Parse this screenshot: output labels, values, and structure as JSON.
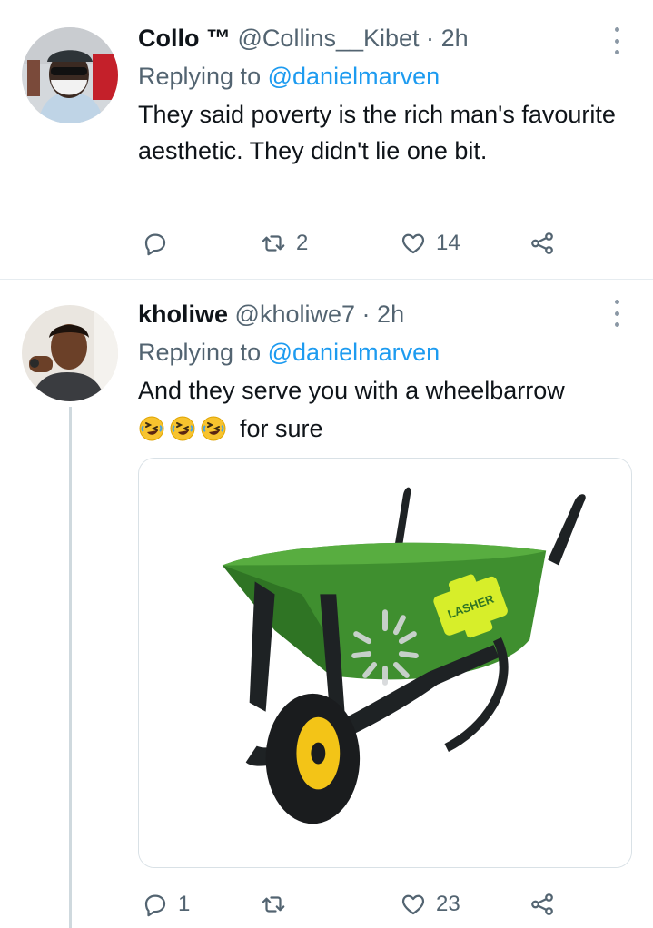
{
  "tweets": [
    {
      "name": "Collo ™",
      "handle": "@Collins__Kibet",
      "separator": "·",
      "time": "2h",
      "replying_prefix": "Replying to",
      "replying_to": "@danielmarven",
      "text": "They said poverty is the rich man's favourite aesthetic. They didn't lie one bit.",
      "stats": {
        "replies": "",
        "retweets": "2",
        "likes": "14"
      }
    },
    {
      "name": "kholiwe",
      "handle": "@kholiwe7",
      "separator": "·",
      "time": "2h",
      "replying_prefix": "Replying to",
      "replying_to": "@danielmarven",
      "text": "And they serve you with a  wheelbarrow",
      "text_suffix": "for sure",
      "emoji": [
        "rolling-on-floor-laughing",
        "rolling-on-floor-laughing",
        "rolling-on-floor-laughing"
      ],
      "media": {
        "brand_text": "LASHER",
        "loading": true
      },
      "stats": {
        "replies": "1",
        "retweets": "",
        "likes": "23"
      }
    }
  ],
  "colors": {
    "text": "#0f1419",
    "secondary": "#536471",
    "link": "#1d9bf0",
    "divider": "#e6ecf0",
    "wheelbarrow_green": "#3f8f2f",
    "wheel_yellow": "#f3c417"
  },
  "icons": {
    "reply": "reply-icon",
    "retweet": "retweet-icon",
    "like": "heart-icon",
    "share": "share-icon",
    "more": "more-icon"
  }
}
